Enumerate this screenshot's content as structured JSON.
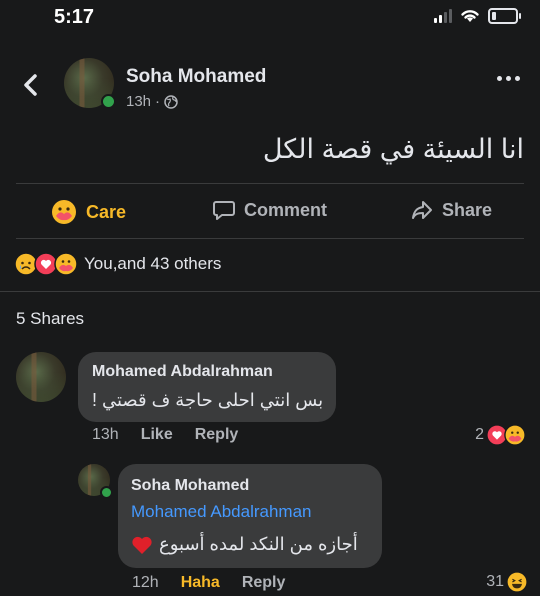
{
  "status_bar": {
    "time": "5:17"
  },
  "post": {
    "author": "Soha Mohamed",
    "time": "13h",
    "separator": "·",
    "text": "انا السيئة في قصة الكل",
    "actions": {
      "care": "Care",
      "comment": "Comment",
      "share": "Share"
    },
    "reactions_summary": "You,and 43 others",
    "shares": "5 Shares"
  },
  "comments": [
    {
      "author": "Mohamed Abdalrahman",
      "text": "بس انتي احلى حاجة ف قصتي !",
      "time": "13h",
      "like": "Like",
      "reply": "Reply",
      "reaction_count": "2"
    }
  ],
  "reply": {
    "author": "Soha Mohamed",
    "mention": "Mohamed Abdalrahman",
    "text": "أجازه من النكد لمده أسبوع",
    "time": "12h",
    "reaction_label": "Haha",
    "reply": "Reply",
    "reaction_count": "31"
  },
  "colors": {
    "background": "#18191a",
    "bubble": "#3a3b3c",
    "care_gold": "#f7b928",
    "mention_blue": "#4599ff",
    "online_green": "#31a24c"
  },
  "icons": [
    "back-icon",
    "globe-icon",
    "more-icon",
    "care-icon",
    "comment-icon",
    "share-icon",
    "sad-reaction-icon",
    "love-reaction-icon",
    "care-reaction-icon",
    "haha-reaction-icon",
    "heart-emoji-icon"
  ]
}
